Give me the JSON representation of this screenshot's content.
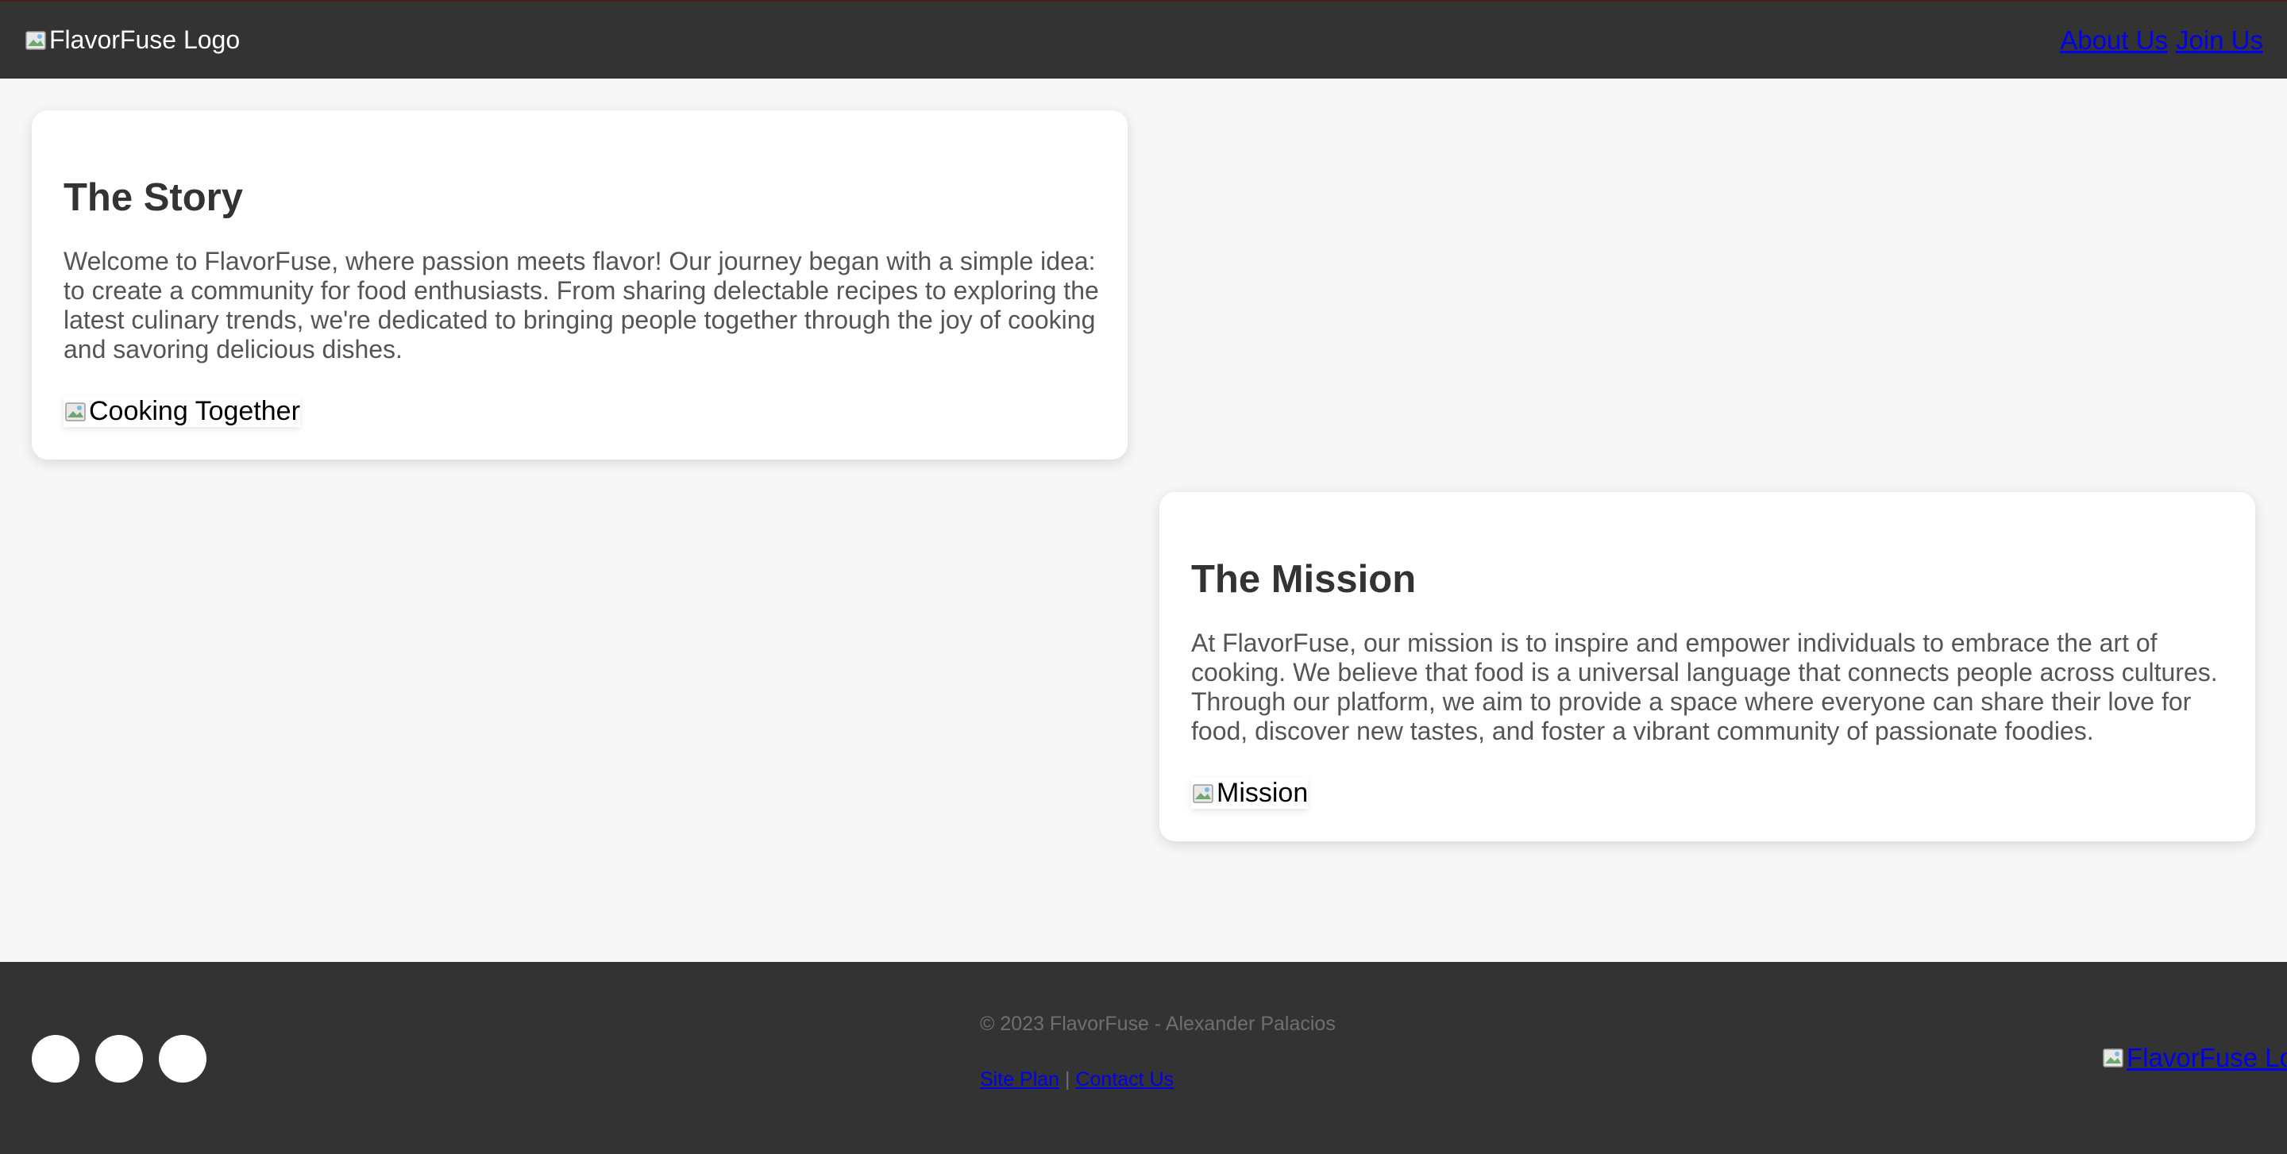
{
  "header": {
    "logo_alt": "FlavorFuse Logo",
    "nav": [
      "About Us",
      "Join Us"
    ]
  },
  "story": {
    "title": "The Story",
    "text": "Welcome to FlavorFuse, where passion meets flavor! Our journey began with a simple idea: to create a community for food enthusiasts. From sharing delectable recipes to exploring the latest culinary trends, we're dedicated to bringing people together through the joy of cooking and savoring delicious dishes.",
    "image_alt": "Cooking Together"
  },
  "mission": {
    "title": "The Mission",
    "text": "At FlavorFuse, our mission is to inspire and empower individuals to embrace the art of cooking. We believe that food is a universal language that connects people across cultures. Through our platform, we aim to provide a space where everyone can share their love for food, discover new tastes, and foster a vibrant community of passionate foodies.",
    "image_alt": "Mission"
  },
  "footer": {
    "copyright": "© 2023 FlavorFuse - Alexander Palacios",
    "links": [
      "Site Plan",
      "Contact Us"
    ],
    "separator": "|",
    "logo_alt": "FlavorFuse Lo",
    "social_icon_count": 3
  },
  "colors": {
    "header_bg": "#333333",
    "page_bg": "#f7f7f7",
    "card_bg": "#ffffff",
    "link": "#0000ee",
    "heading": "#333333",
    "body_text": "#555555"
  },
  "icons": [
    "broken-image-icon",
    "social-icon"
  ]
}
